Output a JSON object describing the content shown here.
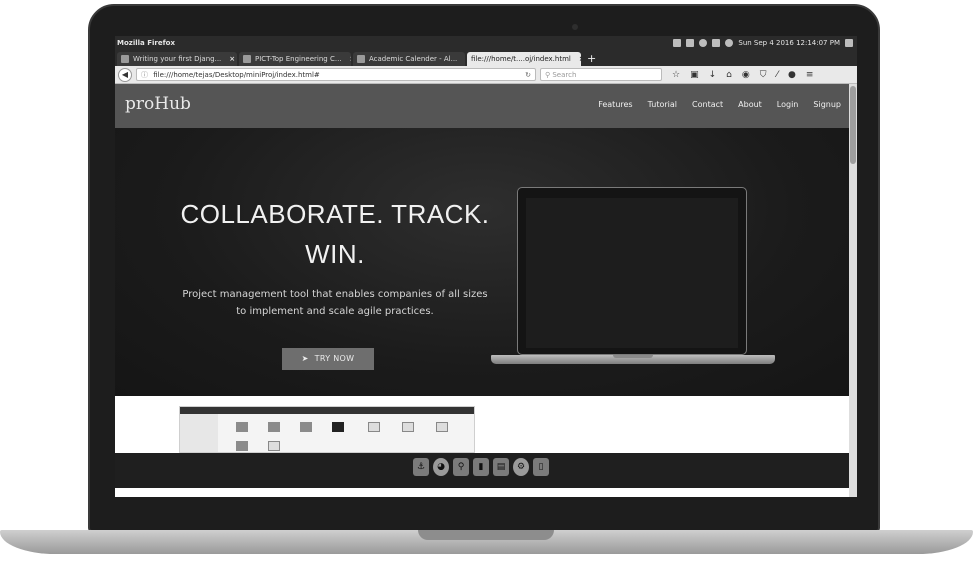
{
  "os": {
    "app_title": "Mozilla Firefox",
    "clock": "Sun Sep  4 2016 12:14:07 PM"
  },
  "browser": {
    "tabs": [
      {
        "label": "Writing your first Djang..."
      },
      {
        "label": "PICT-Top Engineering C..."
      },
      {
        "label": "Academic Calender - Al..."
      },
      {
        "label": "file:///home/t....oj/index.html"
      }
    ],
    "url": "file:///home/tejas/Desktop/miniProj/index.html#",
    "search_placeholder": "Search"
  },
  "site": {
    "brand": "proHub",
    "nav": [
      "Features",
      "Tutorial",
      "Contact",
      "About",
      "Login",
      "Signup"
    ],
    "hero": {
      "heading_line1": "COLLABORATE. TRACK.",
      "heading_line2": "WIN.",
      "subtitle_line1": "Project management tool that enables companies of all sizes",
      "subtitle_line2": "to implement and scale agile practices.",
      "cta": "TRY NOW"
    }
  },
  "icons": {
    "back": "back-arrow-icon",
    "toolbar": [
      "star-icon",
      "clipboard-icon",
      "download-icon",
      "home-icon",
      "pocket-icon",
      "shield-icon",
      "menu-icon"
    ],
    "dock": [
      "anchor-icon",
      "firefox-icon",
      "search-icon",
      "terminal-icon",
      "text-editor-icon",
      "settings-icon",
      "trash-icon"
    ]
  }
}
